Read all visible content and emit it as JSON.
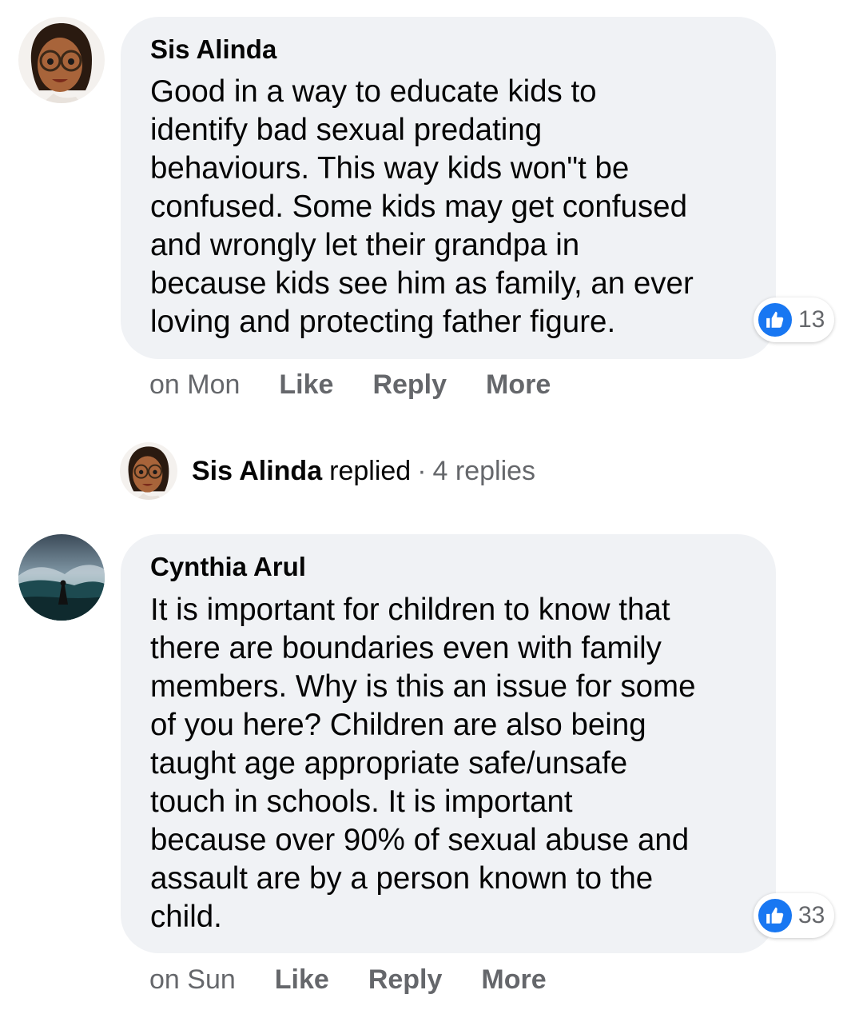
{
  "comments": [
    {
      "author": "Sis Alinda",
      "avatar_icon": "cartoon-woman-glasses-avatar",
      "text": "Good in a way to educate kids to\nidentify bad sexual predating\nbehaviours. This way kids won\"t be\nconfused. Some kids may get confused\nand wrongly let their grandpa in\nbecause kids see him as family, an ever\nloving and protecting father figure.",
      "reaction_icon": "thumbs-up-icon",
      "reaction_count": "13",
      "time": "on Mon",
      "like_label": "Like",
      "reply_label": "Reply",
      "more_label": "More"
    },
    {
      "author": "Cynthia Arul",
      "avatar_icon": "stormy-sea-photo-avatar",
      "text": "It is important for children to know that\nthere are boundaries even with family\nmembers. Why is this an issue for some\nof you here? Children are also being\ntaught age appropriate safe/unsafe\ntouch in schools. It is important\nbecause over 90% of sexual abuse and\nassault are by a person known to the\nchild.",
      "reaction_icon": "thumbs-up-icon",
      "reaction_count": "33",
      "time": "on Sun",
      "like_label": "Like",
      "reply_label": "Reply",
      "more_label": "More"
    }
  ],
  "replies": {
    "name": "Sis Alinda",
    "verb": "replied",
    "separator": "·",
    "count": "4 replies"
  },
  "colors": {
    "bubble": "#f0f2f5",
    "like_blue": "#1877f2",
    "secondary_text": "#65676b",
    "primary_text": "#050505"
  }
}
